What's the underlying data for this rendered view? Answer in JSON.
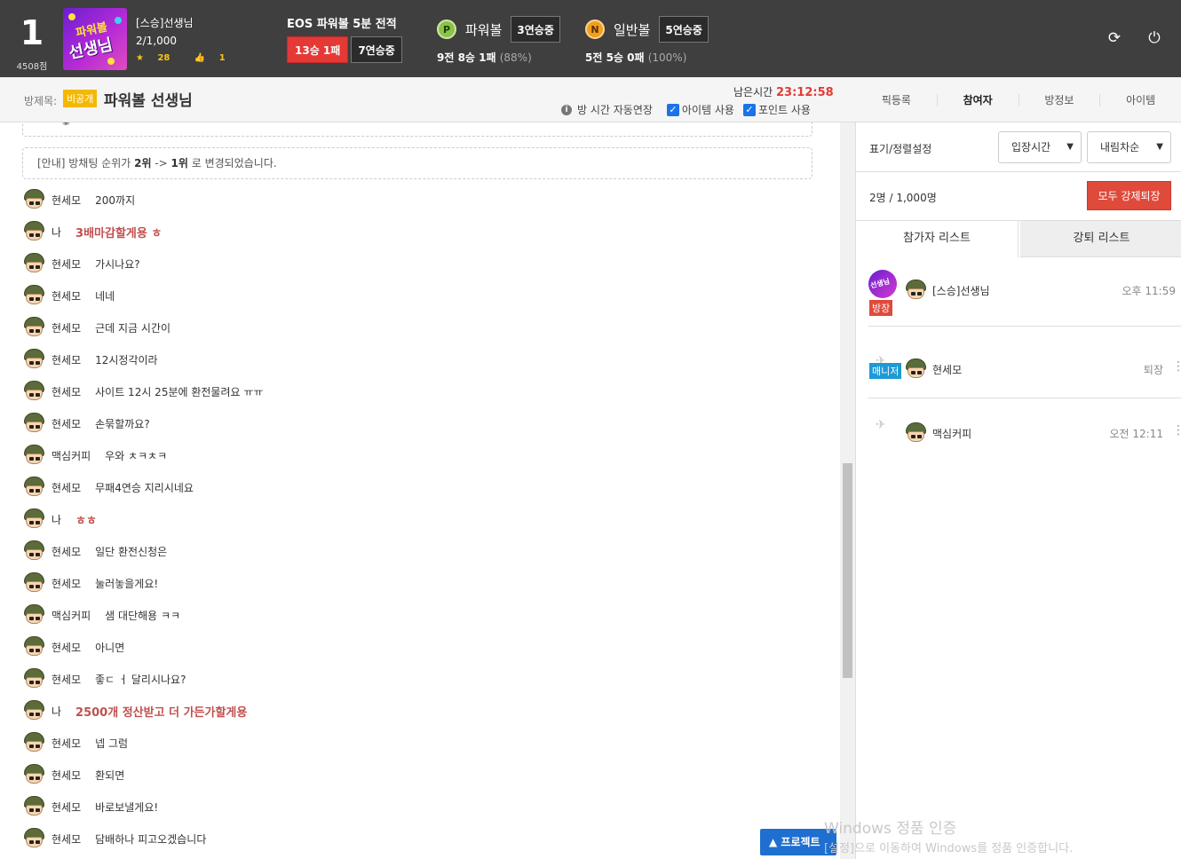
{
  "header": {
    "rank": "1",
    "points": "4508점",
    "avatar_text_top": "파워볼",
    "avatar_text_main": "선생님",
    "host_name": "[스승]선생님",
    "members": "2/1,000",
    "stars": "28",
    "likes": "1",
    "eos_title": "EOS 파워볼 5분 전적",
    "eos_record": "13승 1패",
    "eos_streak": "7연승중",
    "powerball": {
      "icon": "P",
      "name": "파워볼",
      "streak": "3연승중",
      "summary": "9전 8승 1패",
      "pct": "(88%)"
    },
    "normalball": {
      "icon": "N",
      "name": "일반볼",
      "streak": "5연승중",
      "summary": "5전 5승 0패",
      "pct": "(100%)"
    },
    "colors": {
      "bar": "#3f3f3f",
      "red": "#e53935",
      "accent_gold": "#f5c518"
    }
  },
  "subbar": {
    "room_label": "방제목:",
    "private_badge": "비공개",
    "room_name": "파워볼 선생님",
    "remain_label": "남은시간",
    "remain_time": "23:12:58",
    "auto_extend": "방 시간 자동연장",
    "item_use": "아이템 사용",
    "point_use": "포인트 사용",
    "tabs": [
      "픽등록",
      "참여자",
      "방정보",
      "아이템"
    ]
  },
  "chat": {
    "notice_prefix": "[안내] 방채팅 순위가 ",
    "notice_from": "2위",
    "notice_arrow": " -> ",
    "notice_to": "1위",
    "notice_suffix": " 로 변경되었습니다.",
    "messages": [
      {
        "nick": "현세모",
        "text": "200까지",
        "me": false
      },
      {
        "nick": "나",
        "text": "3배마감할게용 ㅎ",
        "me": true
      },
      {
        "nick": "현세모",
        "text": "가시나요?",
        "me": false
      },
      {
        "nick": "현세모",
        "text": "네네",
        "me": false
      },
      {
        "nick": "현세모",
        "text": "근데 지금 시간이",
        "me": false
      },
      {
        "nick": "현세모",
        "text": "12시정각이라",
        "me": false
      },
      {
        "nick": "현세모",
        "text": "사이트 12시 25분에 환전물려요 ㅠㅠ",
        "me": false
      },
      {
        "nick": "현세모",
        "text": "손묶할까요?",
        "me": false
      },
      {
        "nick": "맥심커피",
        "text": "우와 ㅊㅋㅊㅋ",
        "me": false
      },
      {
        "nick": "현세모",
        "text": "무패4연승 지리시네요",
        "me": false
      },
      {
        "nick": "나",
        "text": "ㅎㅎ",
        "me": true
      },
      {
        "nick": "현세모",
        "text": "일단 환전신청은",
        "me": false
      },
      {
        "nick": "현세모",
        "text": "눌러놓을게요!",
        "me": false
      },
      {
        "nick": "맥심커피",
        "text": "샘 대단해용 ㅋㅋ",
        "me": false
      },
      {
        "nick": "현세모",
        "text": "아니면",
        "me": false
      },
      {
        "nick": "현세모",
        "text": "좋ㄷ ㅓ 달리시나요?",
        "me": false
      },
      {
        "nick": "나",
        "text": "2500개 정산받고 더 가든가할게용",
        "me": true
      },
      {
        "nick": "현세모",
        "text": "넵 그럼",
        "me": false
      },
      {
        "nick": "현세모",
        "text": "환되면",
        "me": false
      },
      {
        "nick": "현세모",
        "text": "바로보낼게요!",
        "me": false
      },
      {
        "nick": "현세모",
        "text": "담배하나 피고오겠습니다",
        "me": false
      }
    ]
  },
  "panel": {
    "sort_label": "표기/정렬설정",
    "sort_by": "입장시간",
    "sort_order": "내림차순",
    "count": "2명 / 1,000명",
    "kick_all": "모두 강제퇴장",
    "tab_participants": "참가자 리스트",
    "tab_kicked": "강퇴 리스트",
    "participants": [
      {
        "name": "[스승]선생님",
        "time": "오후 11:59",
        "role": "방장"
      },
      {
        "name": "현세모",
        "time": "퇴장",
        "role": "매니저"
      },
      {
        "name": "맥심커피",
        "time": "오전 12:11",
        "role": ""
      }
    ]
  },
  "footer": {
    "project_button": "▲ 프로젝트",
    "watermark_title": "Windows 정품 인증",
    "watermark_sub": "[설정]으로 이동하여 Windows를 정품 인증합니다."
  }
}
